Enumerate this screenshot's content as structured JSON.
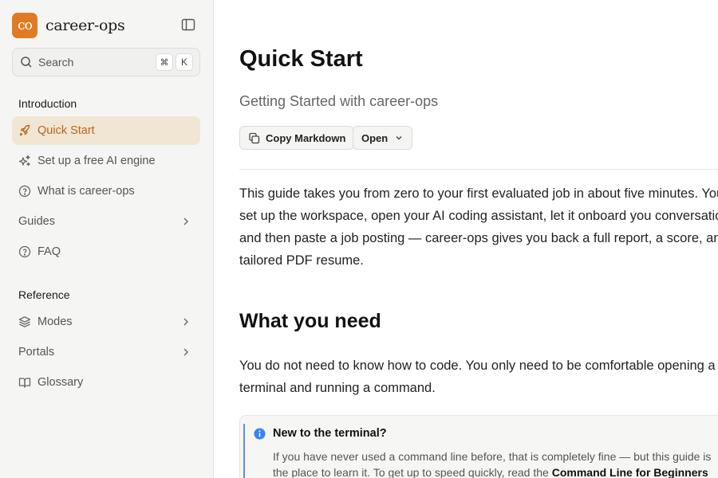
{
  "sidebar": {
    "brand": {
      "logo_text": "co",
      "name": "career-ops",
      "logo_color": "#e07b24"
    },
    "search": {
      "placeholder": "Search",
      "shortcut_modifier": "⌘",
      "shortcut_key": "K"
    },
    "sections": [
      {
        "title": "Introduction",
        "items": [
          {
            "label": "Quick Start",
            "icon": "rocket-icon",
            "active": true
          },
          {
            "label": "Set up a free AI engine",
            "icon": "sparkles-icon"
          },
          {
            "label": "What is career-ops",
            "icon": "help-circle-icon"
          },
          {
            "label": "Guides",
            "icon": "",
            "expandable": true
          },
          {
            "label": "FAQ",
            "icon": "help-circle-icon"
          }
        ]
      },
      {
        "title": "Reference",
        "items": [
          {
            "label": "Modes",
            "icon": "layers-icon",
            "expandable": true
          },
          {
            "label": "Portals",
            "icon": "",
            "expandable": true
          },
          {
            "label": "Glossary",
            "icon": "book-open-icon"
          }
        ]
      }
    ],
    "active_color": "#b8651c",
    "active_bg": "#f1e6d4"
  },
  "main": {
    "title": "Quick Start",
    "subtitle": "Getting Started with career-ops",
    "actions": {
      "copy_label": "Copy Markdown",
      "open_label": "Open"
    },
    "intro_lines": [
      "This guide takes you from zero to your first evaluated job in about five minutes. You will",
      "set up the workspace, open your AI coding assistant, let it onboard you conversationally,",
      "and then paste a job posting — career-ops gives you back a full report, a score, and a",
      "tailored PDF resume."
    ],
    "section_heading": "What you need",
    "need_lines": [
      "You do not need to know how to code. You only need to be comfortable opening a",
      "terminal and running a command."
    ],
    "callout": {
      "title": "New to the terminal?",
      "line1": "If you have never used a command line before, that is completely fine — but this guide is",
      "line2_prefix": "the place to learn it. To get up to speed quickly, read the ",
      "line2_link": "Command Line for Beginners",
      "accent": "#5a8fe8"
    }
  }
}
